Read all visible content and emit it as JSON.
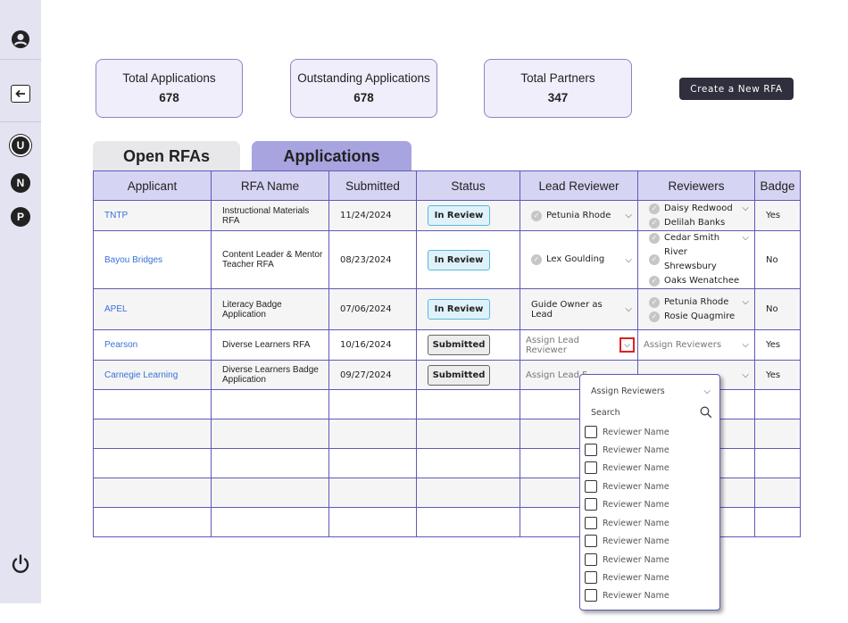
{
  "sidebar": {
    "icons": [
      "user-circle-icon",
      "arrow-left-icon",
      "power-icon"
    ],
    "letters": [
      "U",
      "N",
      "P"
    ]
  },
  "stats": [
    {
      "label": "Total Applications",
      "value": "678"
    },
    {
      "label": "Outstanding Applications",
      "value": "678"
    },
    {
      "label": "Total Partners",
      "value": "347"
    }
  ],
  "create_button": "Create a New RFA",
  "tabs": {
    "open": "Open RFAs",
    "applications": "Applications"
  },
  "table": {
    "headers": [
      "Applicant",
      "RFA Name",
      "Submitted",
      "Status",
      "Lead Reviewer",
      "Reviewers",
      "Badge"
    ],
    "rows": [
      {
        "applicant": "TNTP",
        "rfa_name": "Instructional Materials RFA",
        "submitted": "11/24/2024",
        "status": "In Review",
        "lead": "Petunia Rhode",
        "reviewers": [
          "Daisy Redwood",
          "Delilah Banks"
        ],
        "badge": "Yes"
      },
      {
        "applicant": "Bayou Bridges",
        "rfa_name": "Content Leader & Mentor Teacher RFA",
        "submitted": "08/23/2024",
        "status": "In Review",
        "lead": "Lex Goulding",
        "reviewers": [
          "Cedar Smith",
          "River Shrewsbury",
          "Oaks Wenatchee"
        ],
        "badge": "No"
      },
      {
        "applicant": "APEL",
        "rfa_name": "Literacy Badge Application",
        "submitted": "07/06/2024",
        "status": "In Review",
        "lead": "Guide Owner as Lead",
        "reviewers": [
          "Petunia Rhode",
          "Rosie Quagmire"
        ],
        "badge": "No"
      },
      {
        "applicant": "Pearson",
        "rfa_name": "Diverse Learners RFA",
        "submitted": "10/16/2024",
        "status": "Submitted",
        "lead": "Assign Lead Reviewer",
        "reviewers_placeholder": "Assign Reviewers",
        "badge": "Yes"
      },
      {
        "applicant": "Carnegie Learning",
        "rfa_name": "Diverse Learners Badge Application",
        "submitted": "09/27/2024",
        "status": "Submitted",
        "lead": "Assign Lead F",
        "badge": "Yes"
      }
    ],
    "empty_rows": 5
  },
  "dropdown": {
    "title": "Assign Reviewers",
    "search_placeholder": "Search",
    "items": [
      "Reviewer Name",
      "Reviewer Name",
      "Reviewer Name",
      "Reviewer Name",
      "Reviewer Name",
      "Reviewer Name",
      "Reviewer Name",
      "Reviewer Name",
      "Reviewer Name",
      "Reviewer Name"
    ]
  }
}
